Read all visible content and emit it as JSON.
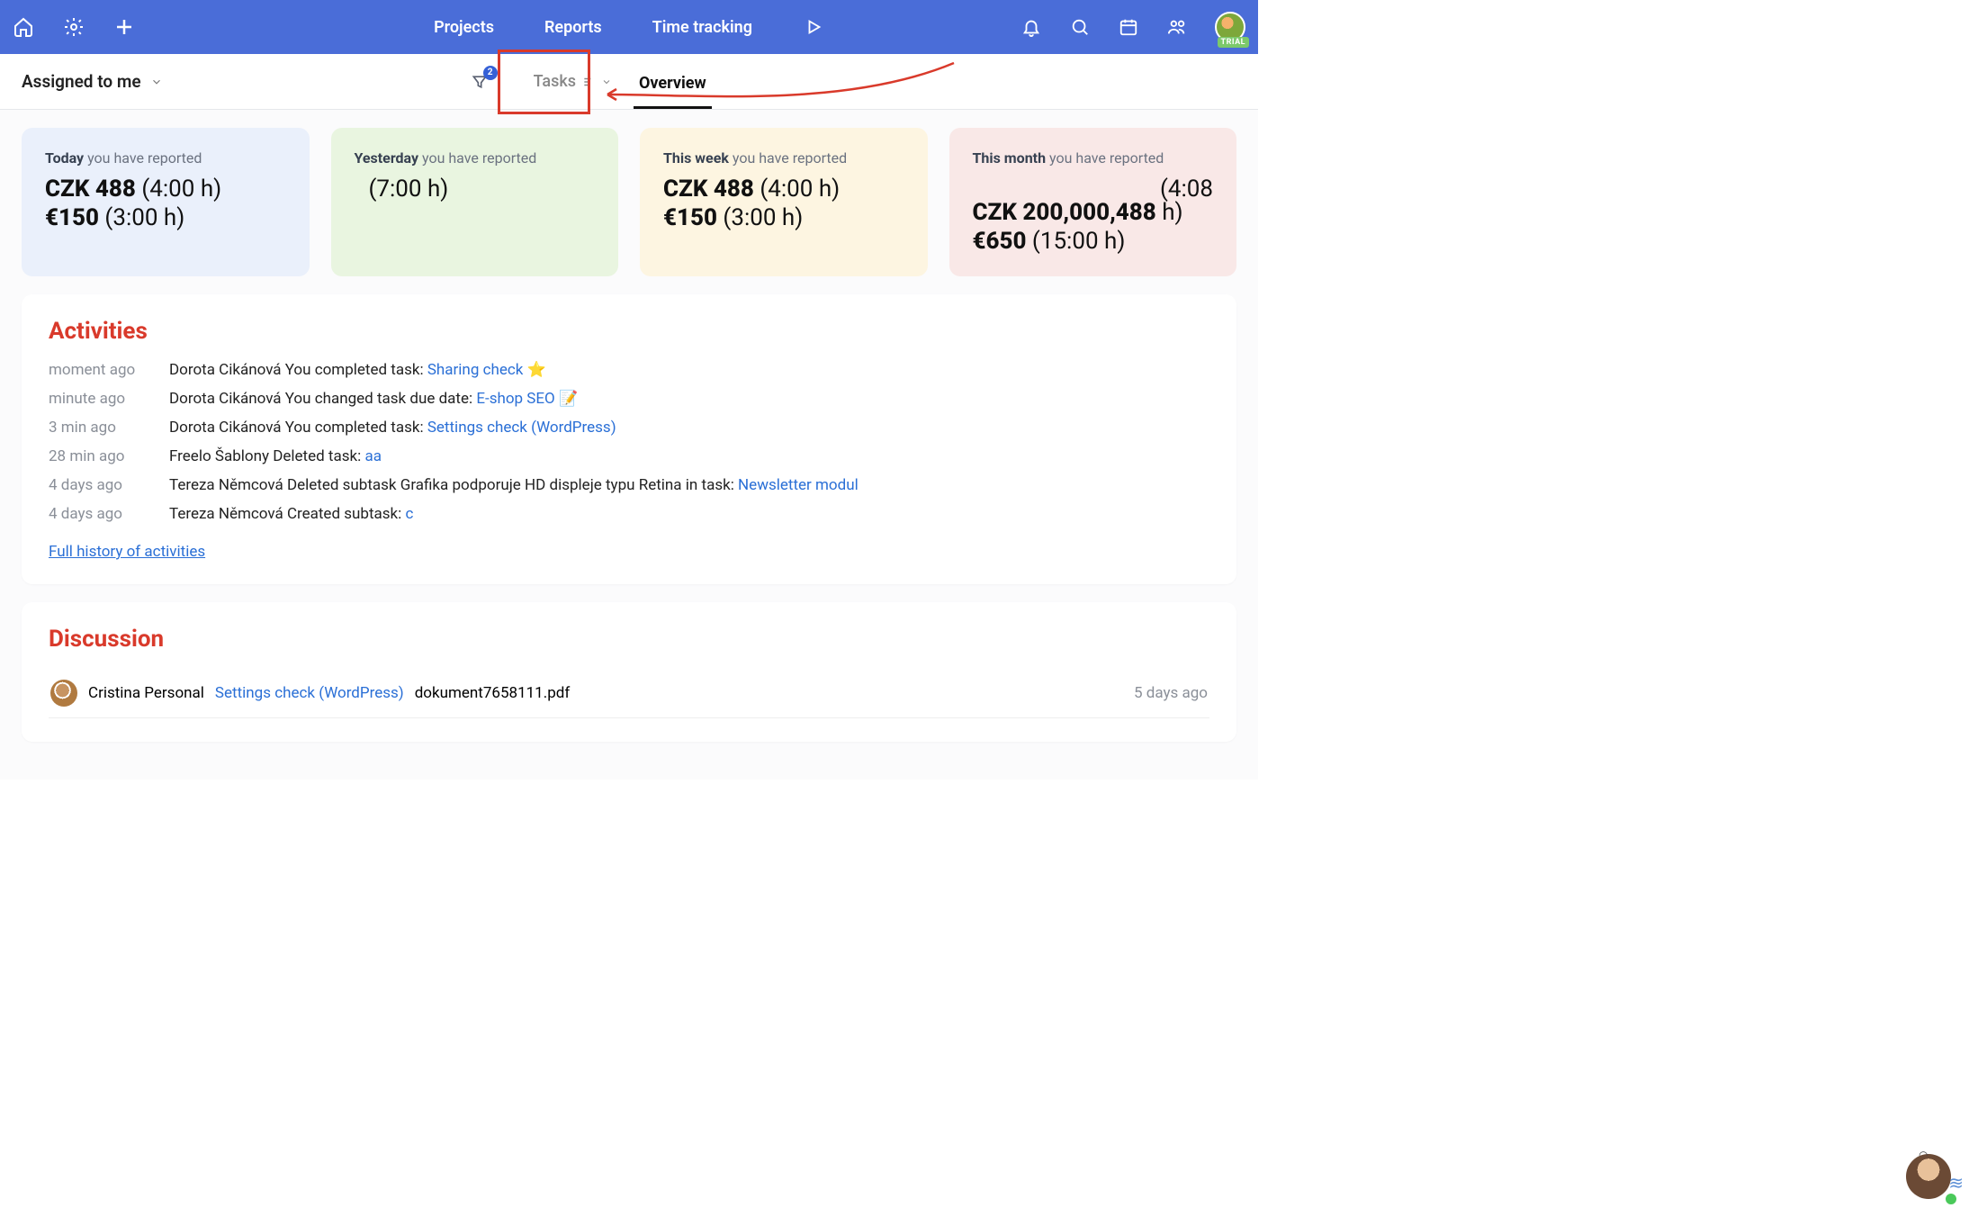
{
  "topbar": {
    "nav": [
      "Projects",
      "Reports",
      "Time tracking"
    ],
    "trial": "TRIAL"
  },
  "subbar": {
    "assigned": "Assigned to me",
    "filter_count": "2",
    "tasks_tab": "Tasks",
    "overview_tab": "Overview"
  },
  "cards": [
    {
      "period": "Today",
      "sub": "you have reported",
      "line1_b": "CZK 488",
      "line1_r": " (4:00 h)",
      "line2_b": "€150",
      "line2_r": " (3:00 h)"
    },
    {
      "period": "Yesterday",
      "sub": "you have reported",
      "line1_b": "",
      "line1_r": "(7:00 h)",
      "line2_b": "",
      "line2_r": ""
    },
    {
      "period": "This week",
      "sub": "you have reported",
      "line1_b": "CZK 488",
      "line1_r": " (4:00 h)",
      "line2_b": "€150",
      "line2_r": " (3:00 h)"
    },
    {
      "period": "This month",
      "sub": "you have reported",
      "float": "(4:08",
      "line1_b": "CZK 200,000,488",
      "line1_r": " h)",
      "line2_b": "€650",
      "line2_r": " (15:00 h)"
    }
  ],
  "activities": {
    "title": "Activities",
    "rows": [
      {
        "time": "moment ago",
        "text": "Dorota Cikánová You completed task: ",
        "link": "Sharing check",
        "tail": " ⭐"
      },
      {
        "time": "minute ago",
        "text": "Dorota Cikánová You changed task due date: ",
        "link": "E-shop SEO",
        "tail": " 📝"
      },
      {
        "time": "3 min ago",
        "text": "Dorota Cikánová You completed task: ",
        "link": "Settings check (WordPress)",
        "tail": ""
      },
      {
        "time": "28 min ago",
        "text": "Freelo Šablony Deleted task: ",
        "link": "aa",
        "tail": ""
      },
      {
        "time": "4 days ago",
        "text": "Tereza Němcová Deleted subtask Grafika podporuje HD displeje typu Retina in task: ",
        "link": "Newsletter modul",
        "tail": ""
      },
      {
        "time": "4 days ago",
        "text": "Tereza Němcová Created subtask: ",
        "link": "c",
        "tail": ""
      }
    ],
    "full_link": "Full history of activities"
  },
  "discussion": {
    "title": "Discussion",
    "rows": [
      {
        "user": "Cristina Personal",
        "link": "Settings check (WordPress)",
        "file": "dokument7658111.pdf",
        "date": "5 days ago"
      }
    ]
  }
}
